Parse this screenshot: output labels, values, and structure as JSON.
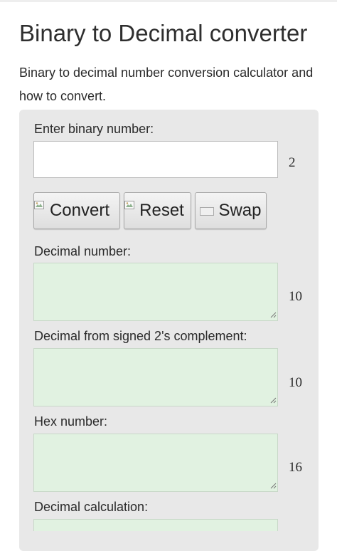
{
  "page": {
    "title": "Binary to Decimal converter",
    "intro": "Binary to decimal number conversion calculator and how to convert."
  },
  "form": {
    "binary_label": "Enter binary number:",
    "binary_value": "",
    "binary_base": "2",
    "buttons": {
      "convert": "Convert",
      "reset": "Reset",
      "swap": "Swap"
    },
    "decimal_label": "Decimal number:",
    "decimal_value": "",
    "decimal_base": "10",
    "signed_label": "Decimal from signed 2's complement:",
    "signed_value": "",
    "signed_base": "10",
    "hex_label": "Hex number:",
    "hex_value": "",
    "hex_base": "16",
    "calc_label": "Decimal calculation:"
  },
  "icons": {
    "convert": "broken-image-icon",
    "reset": "broken-image-icon",
    "swap": "swap-image-icon",
    "grip": "resize-grip-icon"
  },
  "colors": {
    "output_bg": "#e1f2e1",
    "panel_bg": "#e8e8e8"
  }
}
